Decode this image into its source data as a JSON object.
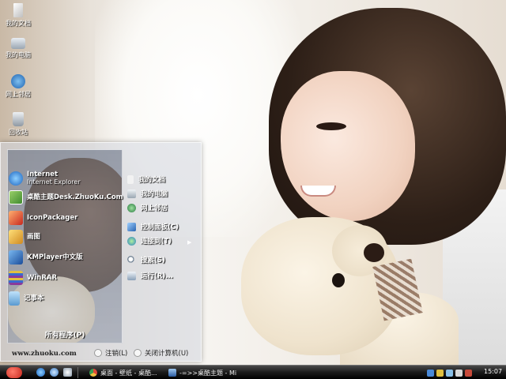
{
  "desktop_icons": [
    {
      "label": "我的文档",
      "icon": "my-documents-icon",
      "color": "#e8e8e8"
    },
    {
      "label": "我的电脑",
      "icon": "my-computer-icon",
      "color": "#cfd8e3"
    },
    {
      "label": "网上邻居",
      "icon": "network-places-icon",
      "color": "#3c86d4"
    },
    {
      "label": "回收站",
      "icon": "recycle-bin-icon",
      "color": "#d0d6dc"
    }
  ],
  "start_menu": {
    "pinned": [
      {
        "title": "Internet",
        "subtitle": "Internet Explorer",
        "icon": "internet-explorer-icon",
        "color": "#2f82d6"
      },
      {
        "title": "桌酷主题Desk.ZhuoKu.Com",
        "subtitle": "",
        "icon": "zhuoku-theme-icon",
        "color": "#5aa845"
      }
    ],
    "programs": [
      {
        "title": "IconPackager",
        "icon": "iconpackager-icon",
        "color": "#d84a3a"
      },
      {
        "title": "画图",
        "icon": "paint-icon",
        "color": "#e0b040"
      },
      {
        "title": "KMPlayer中文版",
        "icon": "kmplayer-icon",
        "color": "#2a7cd0"
      },
      {
        "title": "WinRAR",
        "icon": "winrar-icon",
        "color": "#8a3a9a"
      },
      {
        "title": "记事本",
        "icon": "notepad-icon",
        "color": "#6fb0e0"
      }
    ],
    "all_programs": "所有程序(P)",
    "right_items": [
      {
        "label": "我的文档",
        "icon": "documents-icon",
        "color": "#f0f0f0"
      },
      {
        "label": "我的电脑",
        "icon": "computer-icon",
        "color": "#dde5ee"
      },
      {
        "label": "网上邻居",
        "icon": "network-icon",
        "color": "#3a9b58"
      },
      {
        "label": "控制面板(C)",
        "icon": "control-panel-icon",
        "color": "#4a8fd8"
      },
      {
        "label": "连接到(T)",
        "icon": "connect-to-icon",
        "color": "#3fa8d8"
      },
      {
        "label": "搜索(S)",
        "icon": "search-icon",
        "color": "#e8e8e8"
      },
      {
        "label": "运行(R)...",
        "icon": "run-icon",
        "color": "#dfe7f0"
      }
    ],
    "footer_url": "www.zhuoku.com",
    "logoff": "注销(L)",
    "shutdown": "关闭计算机(U)"
  },
  "taskbar": {
    "tasks": [
      {
        "label": "桌面 - 壁纸 - 桌酷...",
        "icon": "chrome-icon",
        "color": "#e04a3a"
      },
      {
        "label": "-=>>桌酷主题 - Mi...",
        "icon": "window-icon",
        "color": "#5a8fd0"
      }
    ],
    "clock": "15:07"
  }
}
